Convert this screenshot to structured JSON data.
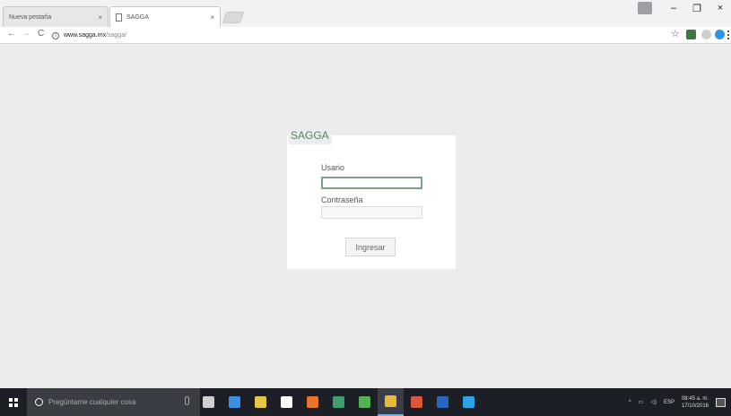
{
  "browser": {
    "tabs": [
      {
        "title": "Nueva pestaña",
        "close": "×"
      },
      {
        "title": "SAGGA",
        "close": "×"
      }
    ],
    "window_controls": {
      "minimize": "–",
      "maximize": "❐",
      "close": "×"
    },
    "nav": {
      "back": "←",
      "forward": "→",
      "reload": "C"
    },
    "url": {
      "host": "www.sagga.mx",
      "path": "/sagga/"
    },
    "star": "☆",
    "info_glyph": "i"
  },
  "login": {
    "title": "SAGGA",
    "user_label": "Usario",
    "user_value": "",
    "password_label": "Contraseña",
    "password_value": "",
    "submit_label": "Ingresar",
    "accent_color": "#4d8a63"
  },
  "taskbar": {
    "search_placeholder": "Pregúntame cualquier cosa",
    "apps": [
      {
        "icon": "task-view-icon",
        "color": "#cfcfcf"
      },
      {
        "icon": "edge-icon",
        "color": "#3a8fe0"
      },
      {
        "icon": "file-explorer-icon",
        "color": "#e8c64a"
      },
      {
        "icon": "store-icon",
        "color": "#ffffff"
      },
      {
        "icon": "app-orange-icon",
        "color": "#e8732c"
      },
      {
        "icon": "app-green-icon",
        "color": "#3f9f6a"
      },
      {
        "icon": "app-green2-icon",
        "color": "#55b155"
      },
      {
        "icon": "chrome-icon",
        "color": "#e7b83a"
      },
      {
        "icon": "powerpoint-icon",
        "color": "#d9583b"
      },
      {
        "icon": "word-icon",
        "color": "#2b65c3"
      },
      {
        "icon": "skype-icon",
        "color": "#2ea3e3"
      }
    ],
    "active_app_index": 7,
    "tray": {
      "chevron": "^",
      "language": "ESP",
      "time": "08:45 a. m.",
      "date": "17/10/2016"
    }
  }
}
